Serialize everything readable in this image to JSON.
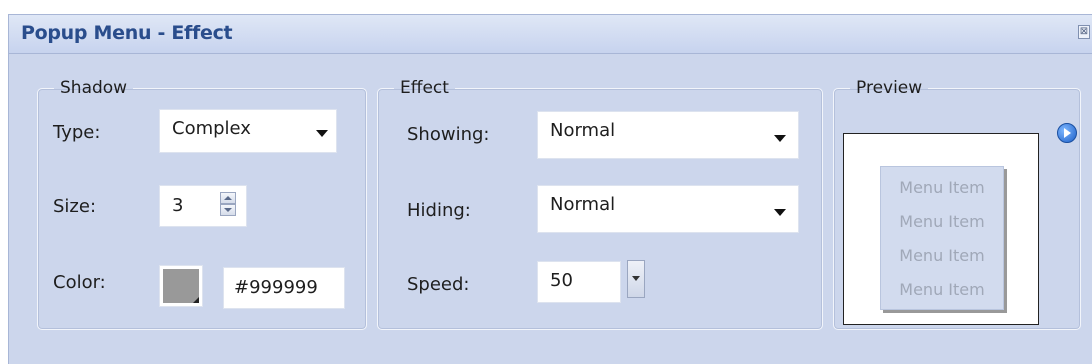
{
  "window": {
    "title": "Popup Menu - Effect",
    "close_glyph": "⊠"
  },
  "shadow": {
    "legend": "Shadow",
    "type_label": "Type:",
    "type_value": "Complex",
    "size_label": "Size:",
    "size_value": "3",
    "color_label": "Color:",
    "color_value": "#999999",
    "swatch_color": "#999999"
  },
  "effect": {
    "legend": "Effect",
    "showing_label": "Showing:",
    "showing_value": "Normal",
    "hiding_label": "Hiding:",
    "hiding_value": "Normal",
    "speed_label": "Speed:",
    "speed_value": "50"
  },
  "preview": {
    "legend": "Preview",
    "play_icon": "play-icon",
    "menu_items": [
      "Menu Item",
      "Menu Item",
      "Menu Item",
      "Menu Item"
    ]
  },
  "colors": {
    "panel_bg": "#ccd6ec",
    "title_text": "#2a4d8c",
    "shadow": "#999999"
  }
}
